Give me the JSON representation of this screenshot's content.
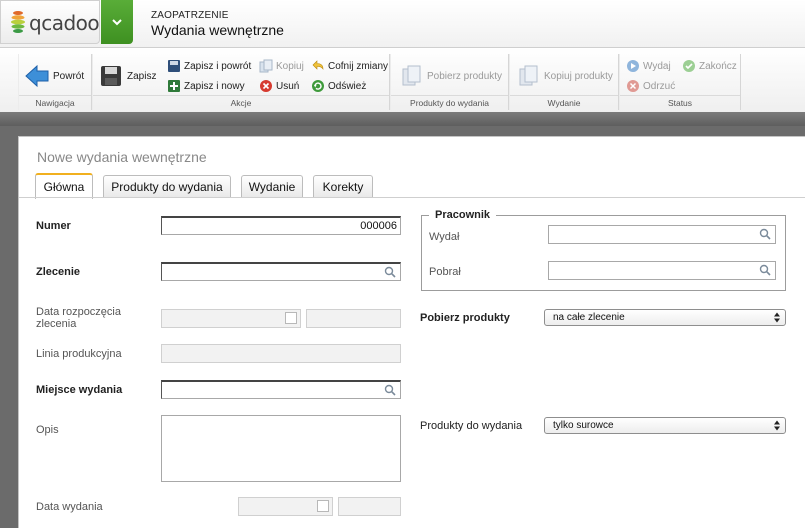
{
  "header": {
    "logo_text": "qcadoo",
    "section": "ZAOPATRZENIE",
    "title": "Wydania wewnętrzne"
  },
  "ribbon": {
    "groups": {
      "navigation": "Nawigacja",
      "actions": "Akcje",
      "products_to_issue": "Produkty do wydania",
      "issue": "Wydanie",
      "status": "Status"
    },
    "buttons": {
      "back": "Powrót",
      "save": "Zapisz",
      "save_back": "Zapisz i powrót",
      "save_new": "Zapisz i nowy",
      "copy": "Kopiuj",
      "delete": "Usuń",
      "undo": "Cofnij zmiany",
      "refresh": "Odśwież",
      "get_products": "Pobierz produkty",
      "copy_products": "Kopiuj produkty",
      "issue": "Wydaj",
      "finish": "Zakończ",
      "reject": "Odrzuć"
    }
  },
  "panel": {
    "title": "Nowe wydania wewnętrzne",
    "tabs": [
      "Główna",
      "Produkty do wydania",
      "Wydanie",
      "Korekty"
    ],
    "active_tab": "Główna"
  },
  "form": {
    "number_label": "Numer",
    "number_value": "000006",
    "order_label": "Zlecenie",
    "order_value": "",
    "start_date_label_1": "Data rozpoczęcia",
    "start_date_label_2": "zlecenia",
    "production_line_label": "Linia produkcyjna",
    "issue_place_label": "Miejsce wydania",
    "description_label": "Opis",
    "issue_date_label": "Data wydania",
    "worker_legend": "Pracownik",
    "issued_by_label": "Wydał",
    "received_by_label": "Pobrał",
    "get_products_label": "Pobierz produkty",
    "get_products_value": "na całe zlecenie",
    "products_to_issue_label": "Produkty do wydania",
    "products_to_issue_value": "tylko surowce"
  }
}
